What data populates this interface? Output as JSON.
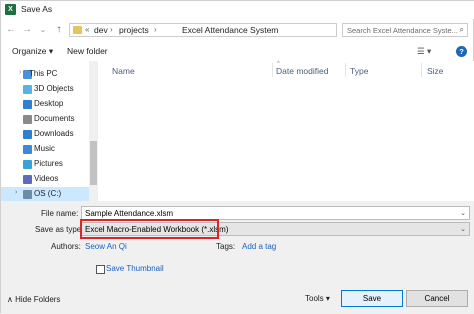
{
  "window": {
    "title": "Save As",
    "app_icon": "X"
  },
  "nav_buttons": {
    "back": "←",
    "forward": "→",
    "recent": "⌄",
    "up": "↑"
  },
  "address": {
    "overflow": "«",
    "crumbs": [
      "dev",
      "projects",
      "Excel Attendance System"
    ],
    "separator": "›",
    "dropdown": "⌄",
    "refresh": "↻"
  },
  "search": {
    "placeholder": "Search Excel Attendance Syste...",
    "icon": "⌕"
  },
  "toolbar": {
    "organize": "Organize ▾",
    "new_folder": "New folder",
    "view_icon": "☰ ▾",
    "help": "?"
  },
  "nav": {
    "items": [
      {
        "label": "This PC",
        "icon": "monitor-icon",
        "color": "#4a90d9"
      },
      {
        "label": "3D Objects",
        "icon": "cube-icon",
        "color": "#5ab0e8"
      },
      {
        "label": "Desktop",
        "icon": "desktop-icon",
        "color": "#2f7fd0"
      },
      {
        "label": "Documents",
        "icon": "documents-icon",
        "color": "#8a8a8a"
      },
      {
        "label": "Downloads",
        "icon": "download-icon",
        "color": "#2f7fd0"
      },
      {
        "label": "Music",
        "icon": "music-icon",
        "color": "#3b8ad9"
      },
      {
        "label": "Pictures",
        "icon": "pictures-icon",
        "color": "#3aa0d9"
      },
      {
        "label": "Videos",
        "icon": "videos-icon",
        "color": "#5c6bc0"
      },
      {
        "label": "OS (C:)",
        "icon": "drive-icon",
        "color": "#6c8ca8"
      }
    ]
  },
  "columns": {
    "name": "Name",
    "date": "Date modified",
    "type": "Type",
    "size": "Size"
  },
  "form": {
    "file_name_label": "File name:",
    "file_name_value": "Sample Attendance.xlsm",
    "save_type_label": "Save as type:",
    "save_type_value": "Excel Macro-Enabled Workbook (*.xlsm)",
    "authors_label": "Authors:",
    "authors_value": "Seow An Qi",
    "tags_label": "Tags:",
    "tags_value": "Add a tag",
    "thumbnail_label": "Save Thumbnail"
  },
  "footer": {
    "hide_folders": "Hide Folders",
    "tools": "Tools ▾",
    "save": "Save",
    "cancel": "Cancel"
  },
  "colors": {
    "accent": "#0078d7",
    "highlight_border": "#d8262b",
    "link": "#1a62c4"
  }
}
